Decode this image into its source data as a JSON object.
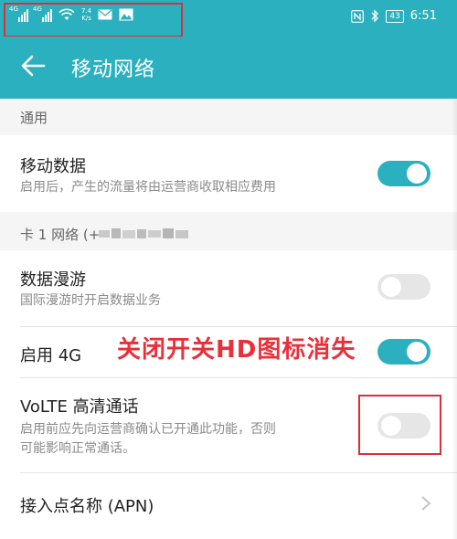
{
  "status_bar": {
    "net_speed_value": "7.4",
    "net_speed_unit": "K/s",
    "signal1_label": "4G",
    "signal2_label": "4G",
    "battery": "43",
    "time": "6:51"
  },
  "app_bar": {
    "title": "移动网络"
  },
  "sections": [
    {
      "label": "通用"
    },
    {
      "label": "卡 1 网络 (+"
    }
  ],
  "rows": {
    "mobile_data": {
      "title": "移动数据",
      "subtitle": "启用后，产生的流量将由运营商收取相应费用",
      "enabled": true
    },
    "roaming": {
      "title": "数据漫游",
      "subtitle": "国际漫游时开启数据业务",
      "enabled": false
    },
    "enable_4g": {
      "title": "启用 4G",
      "enabled": true
    },
    "volte": {
      "title": "VoLTE 高清通话",
      "subtitle_line1": "启用前应先向运营商确认已开通此功能，否则",
      "subtitle_line2": "可能影响正常通话。",
      "enabled": false
    },
    "apn": {
      "title": "接入点名称 (APN)"
    }
  },
  "annotation": {
    "text": "关闭开关HD图标消失"
  },
  "colors": {
    "accent": "#2bb0bf",
    "annotation": "#e8303a"
  }
}
